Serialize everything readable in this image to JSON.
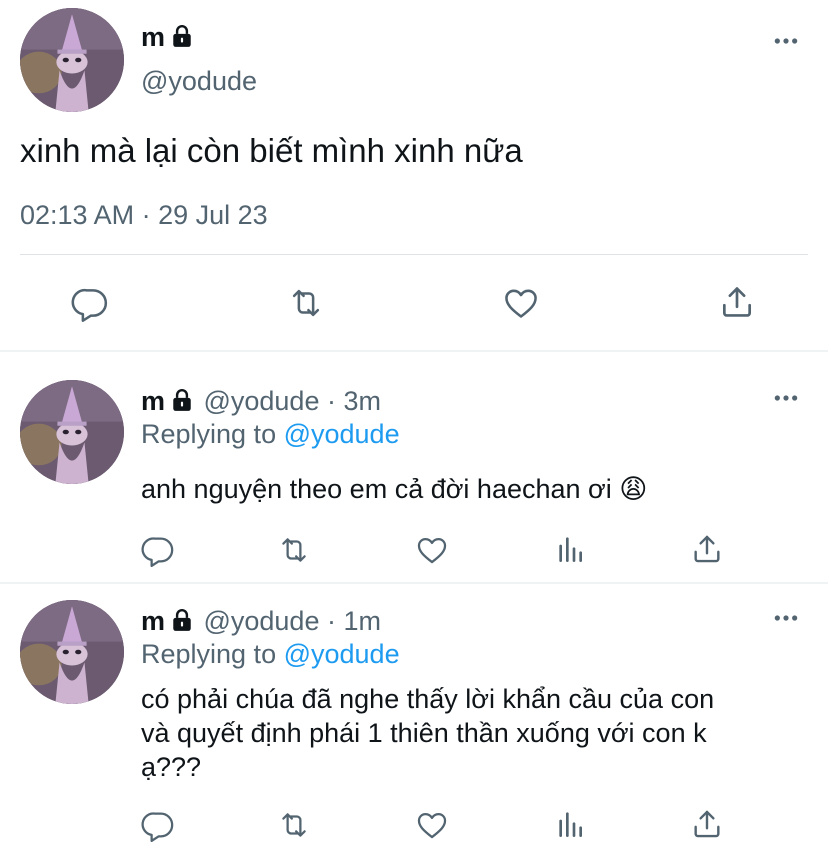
{
  "main_tweet": {
    "name": "m",
    "handle": "@yodude",
    "text": "xinh mà lại còn biết mình xinh nữa",
    "timestamp": "02:13 AM · 29 Jul 23"
  },
  "replies": [
    {
      "name": "m",
      "handle": "@yodude",
      "time": " · 3m",
      "replying_prefix": "Replying to ",
      "replying_handle": "@yodude",
      "text": "anh nguyện theo em cả đời haechan ơi 😩"
    },
    {
      "name": "m",
      "handle": "@yodude",
      "time": " · 1m",
      "replying_prefix": "Replying to ",
      "replying_handle": "@yodude",
      "text_lines": [
        "có phải chúa đã nghe thấy lời khẩn cầu của con",
        "và quyết định phái 1 thiên thần xuống với con k",
        "ạ???"
      ]
    }
  ],
  "icons": {
    "lock": "lock-icon",
    "more": "more-icon",
    "reply": "reply-icon",
    "retweet": "retweet-icon",
    "like": "like-icon",
    "views": "views-icon",
    "share": "share-icon"
  },
  "colors": {
    "text": "#0f1419",
    "secondary": "#536471",
    "link": "#1d9bf0",
    "divider": "#eff3f4"
  }
}
